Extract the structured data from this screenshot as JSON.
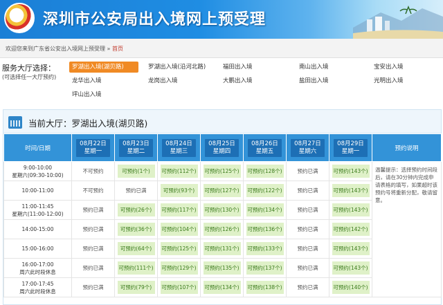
{
  "header": {
    "title": "深圳市公安局出入境网上预受理"
  },
  "breadcrumb": {
    "welcome": "欢迎您来到广东省公安出入境网上预受理 » ",
    "home": "首页"
  },
  "hall_select": {
    "label": "服务大厅选择：",
    "sub": "(可选择任一大厅预约)",
    "halls": [
      "罗湖出入境(湖贝路)",
      "罗湖出入境(沿河北路)",
      "福田出入境",
      "南山出入境",
      "宝安出入境",
      "龙华出入境",
      "龙岗出入境",
      "大鹏出入境",
      "盐田出入境",
      "光明出入境",
      "坪山出入境"
    ]
  },
  "panel": {
    "title": "当前大厅：罗湖出入境(湖贝路)"
  },
  "table": {
    "time_header": "时间/日期",
    "note_header": "预约说明",
    "dates": [
      {
        "date": "08月22日",
        "day": "星期一"
      },
      {
        "date": "08月23日",
        "day": "星期二"
      },
      {
        "date": "08月24日",
        "day": "星期三"
      },
      {
        "date": "08月25日",
        "day": "星期四"
      },
      {
        "date": "08月26日",
        "day": "星期五"
      },
      {
        "date": "08月27日",
        "day": "星期六"
      },
      {
        "date": "08月29日",
        "day": "星期一"
      }
    ],
    "note": "温馨提示：选择预约时间段后，请在30分钟内完成申请表格的填写，如果超时该预约号将重新分配，敬请留意。",
    "rows": [
      {
        "time1": "9:00-10:00",
        "time2": "星期六(09:30-10:00)",
        "cells": [
          "不可预约",
          "可预约(1个)",
          "可预约(112个)",
          "可预约(125个)",
          "可预约(128个)",
          "预约已满",
          "可预约(143个)"
        ]
      },
      {
        "time1": "10:00-11:00",
        "time2": "",
        "cells": [
          "不可预约",
          "预约已满",
          "可预约(93个)",
          "可预约(127个)",
          "可预约(122个)",
          "预约已满",
          "可预约(143个)"
        ]
      },
      {
        "time1": "11:00-11:45",
        "time2": "星期六(11:00-12:00)",
        "cells": [
          "预约已满",
          "可预约(26个)",
          "可预约(117个)",
          "可预约(130个)",
          "可预约(134个)",
          "预约已满",
          "可预约(143个)"
        ]
      },
      {
        "time1": "14:00-15:00",
        "time2": "",
        "cells": [
          "预约已满",
          "可预约(36个)",
          "可预约(104个)",
          "可预约(126个)",
          "可预约(136个)",
          "预约已满",
          "可预约(142个)"
        ]
      },
      {
        "time1": "15:00-16:00",
        "time2": "",
        "cells": [
          "预约已满",
          "可预约(64个)",
          "可预约(125个)",
          "可预约(131个)",
          "可预约(133个)",
          "预约已满",
          "可预约(143个)"
        ]
      },
      {
        "time1": "16:00-17:00",
        "time2": "周六此时段休息",
        "cells": [
          "预约已满",
          "可预约(111个)",
          "可预约(129个)",
          "可预约(135个)",
          "可预约(137个)",
          "预约已满",
          "可预约(143个)"
        ]
      },
      {
        "time1": "17:00-17:45",
        "time2": "周六此时段休息",
        "cells": [
          "预约已满",
          "可预约(79个)",
          "可预约(107个)",
          "可预约(134个)",
          "可预约(138个)",
          "预约已满",
          "可预约(140个)"
        ]
      }
    ]
  }
}
